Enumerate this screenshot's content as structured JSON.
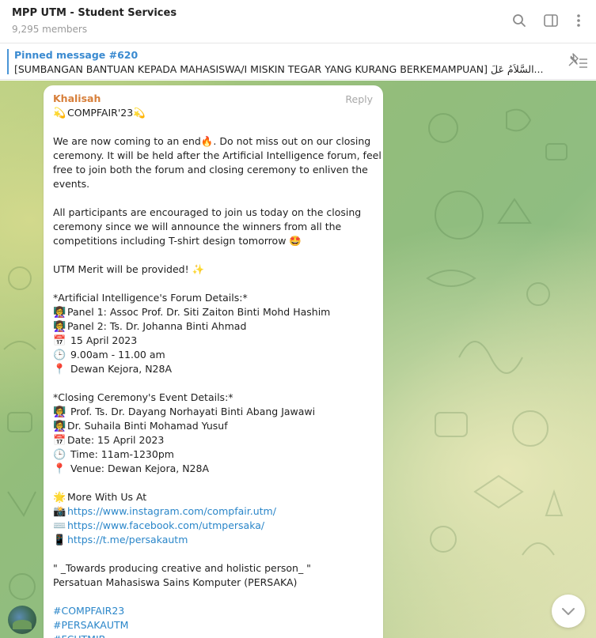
{
  "header": {
    "title": "MPP UTM - Student Services",
    "members": "9,295 members",
    "icons": [
      "search-icon",
      "sidebar-toggle-icon",
      "more-vertical-icon"
    ]
  },
  "pinned": {
    "label": "Pinned message #620",
    "text": "[SUMBANGAN BANTUAN KEPADA MAHASISWA/I MISKIN TEGAR YANG KURANG BERKEMAMPUAN]  السَّلاَمُ عَلَ..."
  },
  "message": {
    "sender": "Khalisah",
    "reply": "Reply",
    "lines": [
      {
        "emoji": "💫",
        "text": "COMPFAIR'23💫"
      },
      {
        "gap": true
      },
      {
        "text": "We are now coming to an end🔥. Do not miss out on  our closing"
      },
      {
        "text": "ceremony. It will be held after the Artificial Intelligence forum, feel"
      },
      {
        "text": "free to join both the forum and closing ceremony to enliven the"
      },
      {
        "text": "events."
      },
      {
        "gap": true
      },
      {
        "text": "All participants are encouraged to join us today on the closing"
      },
      {
        "text": "ceremony since we will  announce the winners from all the"
      },
      {
        "text": "competitions including T-shirt design tomorrow 🤩"
      },
      {
        "gap": true
      },
      {
        "text": "UTM Merit will be provided! ✨"
      },
      {
        "gap": true
      },
      {
        "text": "*Artificial Intelligence's Forum Details:*"
      },
      {
        "emoji": "👩‍🏫",
        "text": "Panel 1: Assoc Prof. Dr. Siti Zaiton Binti Mohd Hashim"
      },
      {
        "emoji": "👩‍🏫",
        "text": "Panel 2: Ts. Dr. Johanna Binti Ahmad"
      },
      {
        "emoji": "📅",
        "text": " 15 April 2023"
      },
      {
        "emoji": "🕒",
        "text": " 9.00am - 11.00 am"
      },
      {
        "emoji": "📍",
        "text": " Dewan Kejora, N28A"
      },
      {
        "gap": true
      },
      {
        "text": "*Closing Ceremony's Event Details:*"
      },
      {
        "emoji": "👩‍🏫",
        "text": " Prof. Ts. Dr. Dayang Norhayati Binti Abang Jawawi"
      },
      {
        "emoji": "👩‍🏫",
        "text": "Dr. Suhaila Binti Mohamad Yusuf"
      },
      {
        "emoji": "📅",
        "text": "Date: 15 April 2023"
      },
      {
        "emoji": "🕒",
        "text": " Time: 11am-1230pm"
      },
      {
        "emoji": "📍",
        "text": " Venue: Dewan Kejora, N28A"
      },
      {
        "gap": true
      },
      {
        "emoji": "🌟",
        "text": "More With Us At"
      },
      {
        "emoji": "📸",
        "link": "https://www.instagram.com/compfair.utm/"
      },
      {
        "emoji": "⌨️",
        "link": "https://www.facebook.com/utmpersaka/"
      },
      {
        "emoji": "📱",
        "link": "https://t.me/persakautm"
      },
      {
        "gap": true
      },
      {
        "text": "\" _Towards producing creative and holistic person_ \""
      },
      {
        "text": "Persatuan Mahasiswa Sains Komputer (PERSAKA)"
      },
      {
        "gap": true
      },
      {
        "link": "#COMPFAIR23"
      },
      {
        "link": "#PERSAKAUTM"
      },
      {
        "link": "#FCUTMJB"
      }
    ]
  },
  "scroll_button": {
    "icon": "chevron-down-icon"
  },
  "colors": {
    "accent": "#3a8ad0",
    "sender": "#d77f3a",
    "link": "#2a86c9"
  }
}
